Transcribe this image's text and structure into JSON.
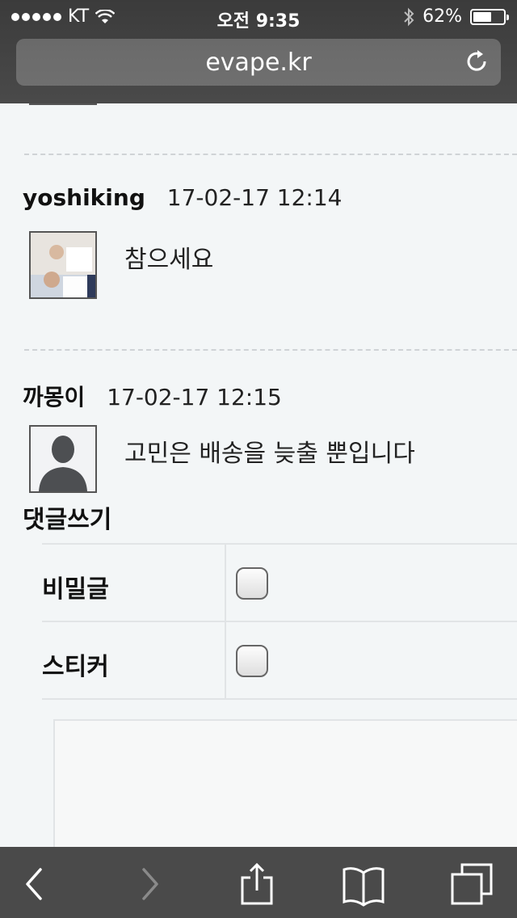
{
  "status": {
    "carrier": "KT",
    "time": "오전 9:35",
    "battery": "62%",
    "battery_level": 0.62
  },
  "browser": {
    "url": "evape.kr"
  },
  "comments": [
    {
      "author": "yoshiking",
      "date": "17-02-17 12:14",
      "text": "참으세요"
    },
    {
      "author": "까몽이",
      "date": "17-02-17 12:15",
      "text": "고민은 배송을 늦출 뿐입니다"
    }
  ],
  "write": {
    "title": "댓글쓰기",
    "secret_label": "비밀글",
    "sticker_label": "스티커"
  },
  "icons": {
    "back": "back-icon",
    "forward": "forward-icon",
    "share": "share-icon",
    "bookmarks": "bookmarks-icon",
    "tabs": "tabs-icon",
    "reload": "reload-icon",
    "wifi": "wifi-icon",
    "bluetooth": "bluetooth-icon"
  }
}
